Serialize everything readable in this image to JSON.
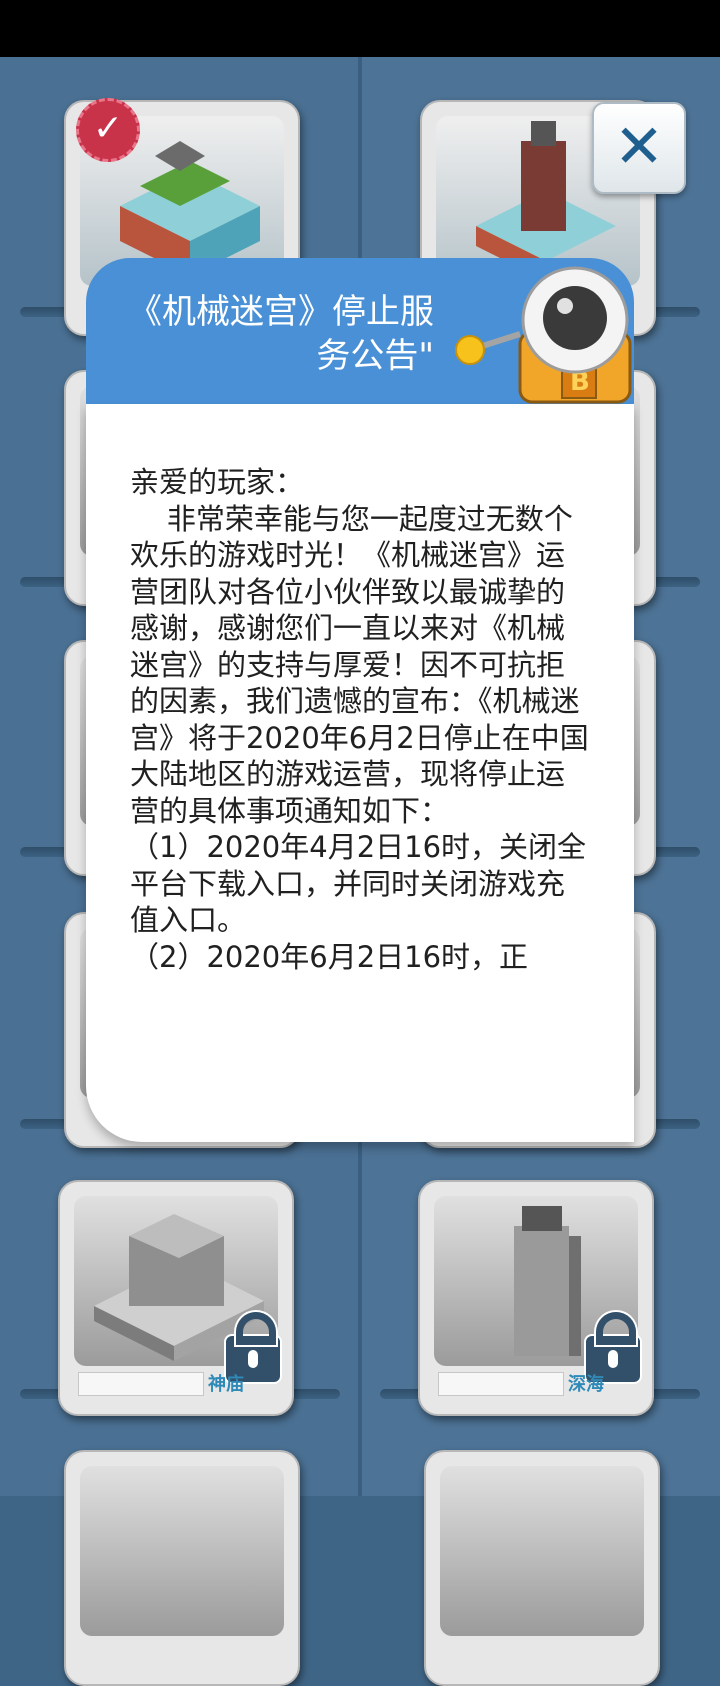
{
  "levels": [
    {
      "name": "神庙",
      "locked": true
    },
    {
      "name": "深海",
      "locked": true
    }
  ],
  "close_button": {
    "icon": "close-icon",
    "color": "#1f5f8f"
  },
  "notice": {
    "title": "《机械迷宫》停止服务公告\"",
    "body": "亲爱的玩家：\n    非常荣幸能与您一起度过无数个欢乐的游戏时光！《机械迷宫》运营团队对各位小伙伴致以最诚挚的感谢，感谢您们一直以来对《机械迷宫》的支持与厚爱！因不可抗拒的因素，我们遗憾的宣布：《机械迷宫》将于2020年6月2日停止在中国大陆地区的游戏运营，现将停止运营的具体事项通知如下：\n（1）2020年4月2日16时，关闭全平台下载入口，并同时关闭游戏充值入口。\n（2）2020年6月2日16时，正",
    "header_color": "#4a90d6"
  },
  "colors": {
    "background": "#4a7093",
    "accent": "#4a90d6"
  }
}
